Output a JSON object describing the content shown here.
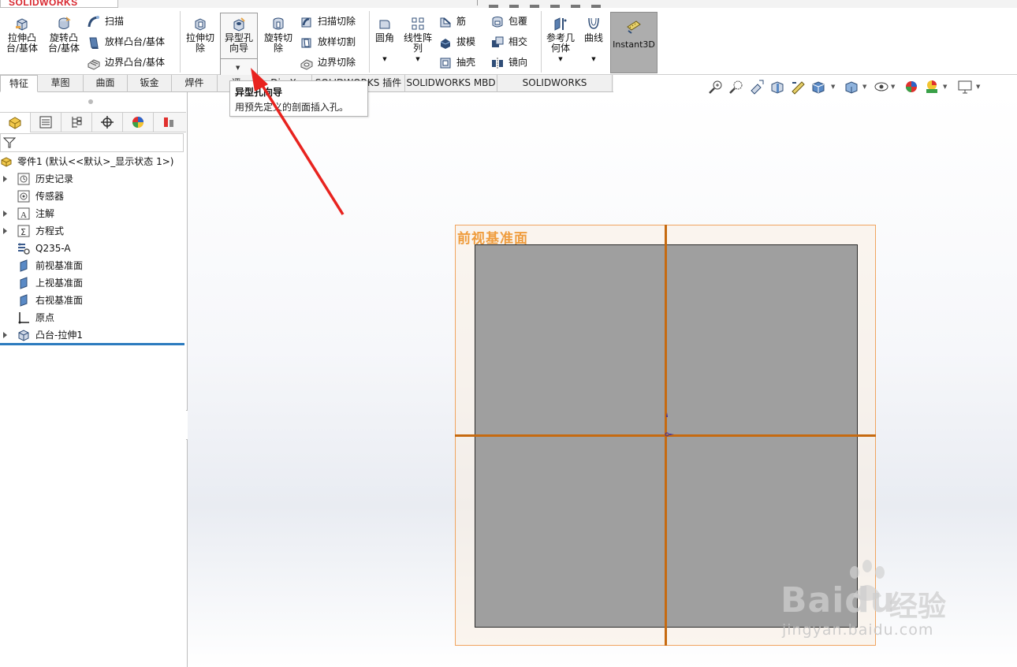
{
  "app": {
    "logo_text": "SOLIDWORKS"
  },
  "ribbon": {
    "extrude_boss": "拉伸凸\n台/基体",
    "revolve_boss": "旋转凸\n台/基体",
    "sweep": "扫描",
    "loft_boss": "放样凸台/基体",
    "boundary_boss": "边界凸台/基体",
    "extrude_cut": "拉伸切\n除",
    "hole_wizard": "异型孔\n向导",
    "revolve_cut": "旋转切\n除",
    "swept_cut": "扫描切除",
    "lofted_cut": "放样切割",
    "boundary_cut": "边界切除",
    "fillet": "圆角",
    "linear_pattern": "线性阵\n列",
    "rib": "筋",
    "draft": "拔模",
    "shell": "抽壳",
    "wrap": "包覆",
    "intersect": "相交",
    "mirror": "镜向",
    "reference_geometry": "参考几\n何体",
    "curves": "曲线",
    "instant3d": "Instant3D"
  },
  "tabs": [
    {
      "label": "特征",
      "active": true
    },
    {
      "label": "草图"
    },
    {
      "label": "曲面"
    },
    {
      "label": "钣金"
    },
    {
      "label": "焊件"
    },
    {
      "label": "评"
    },
    {
      "label": "DimX"
    },
    {
      "label": "SOLIDWORKS 插件"
    },
    {
      "label": "SOLIDWORKS MBD"
    },
    {
      "label": "SOLIDWORKS Inspection"
    }
  ],
  "tooltip": {
    "title": "异型孔向导",
    "description": "用预先定义的剖面插入孔。"
  },
  "feature_tree": {
    "part_name": "零件1  (默认<<默认>_显示状态 1>)",
    "items": [
      {
        "label": "历史记录",
        "expandable": true,
        "icon": "history-icon"
      },
      {
        "label": "传感器",
        "expandable": false,
        "icon": "sensor-icon"
      },
      {
        "label": "注解",
        "expandable": true,
        "icon": "annotation-icon"
      },
      {
        "label": "方程式",
        "expandable": true,
        "icon": "equation-icon"
      },
      {
        "label": "Q235-A",
        "expandable": false,
        "icon": "material-icon"
      },
      {
        "label": "前视基准面",
        "expandable": false,
        "icon": "plane-icon"
      },
      {
        "label": "上视基准面",
        "expandable": false,
        "icon": "plane-icon"
      },
      {
        "label": "右视基准面",
        "expandable": false,
        "icon": "plane-icon"
      },
      {
        "label": "原点",
        "expandable": false,
        "icon": "origin-icon"
      },
      {
        "label": "凸台-拉伸1",
        "expandable": true,
        "icon": "extrude-feature-icon"
      }
    ]
  },
  "viewport": {
    "plane_label": "前视基准面"
  },
  "watermark": {
    "brand": "Baidu",
    "jy": "经验",
    "url": "jingyan.baidu.com"
  },
  "colors": {
    "accent_orange": "#ef9c3d",
    "axis_orange": "#c66a10",
    "part_gray": "#9f9f9f",
    "annotation_red": "#e8231f",
    "rollback_blue": "#2c7bbf",
    "logo_red": "#d8262e"
  }
}
